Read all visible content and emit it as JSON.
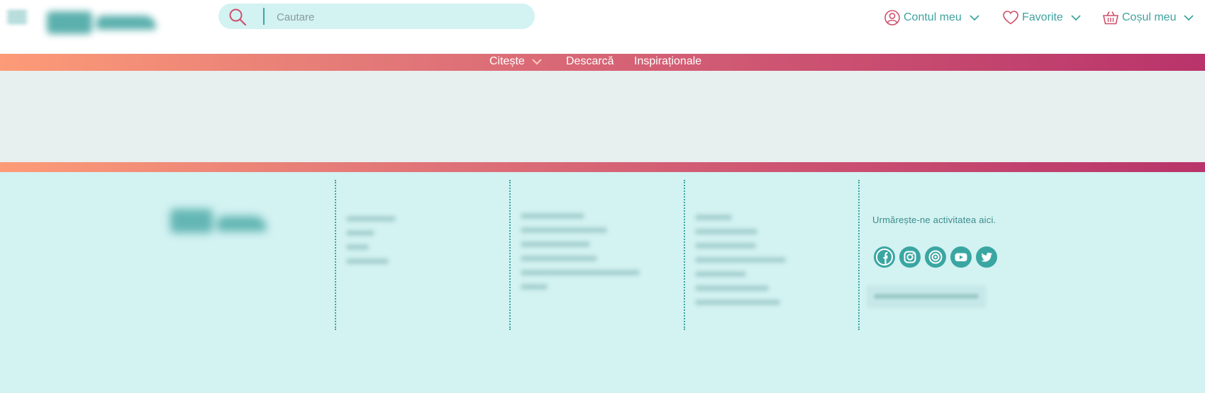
{
  "header": {
    "search_placeholder": "Cautare",
    "account_label": "Contul meu",
    "favorites_label": "Favorite",
    "cart_label": "Coșul meu"
  },
  "nav": {
    "items": [
      {
        "label": "Citește",
        "has_dropdown": true
      },
      {
        "label": "Descarcă",
        "has_dropdown": false
      },
      {
        "label": "Inspiraționale",
        "has_dropdown": false
      }
    ]
  },
  "footer": {
    "follow_text": "Urmărește-ne activitatea aici.",
    "social_icons": [
      "facebook-icon",
      "instagram-icon",
      "camera-icon",
      "youtube-icon",
      "twitter-icon"
    ]
  },
  "colors": {
    "teal": "#3aa6a2",
    "mint_bg": "#d3f2f2",
    "rose": "#cf4f6b",
    "gradient_start": "#fc9b77",
    "gradient_end": "#b8346a"
  }
}
